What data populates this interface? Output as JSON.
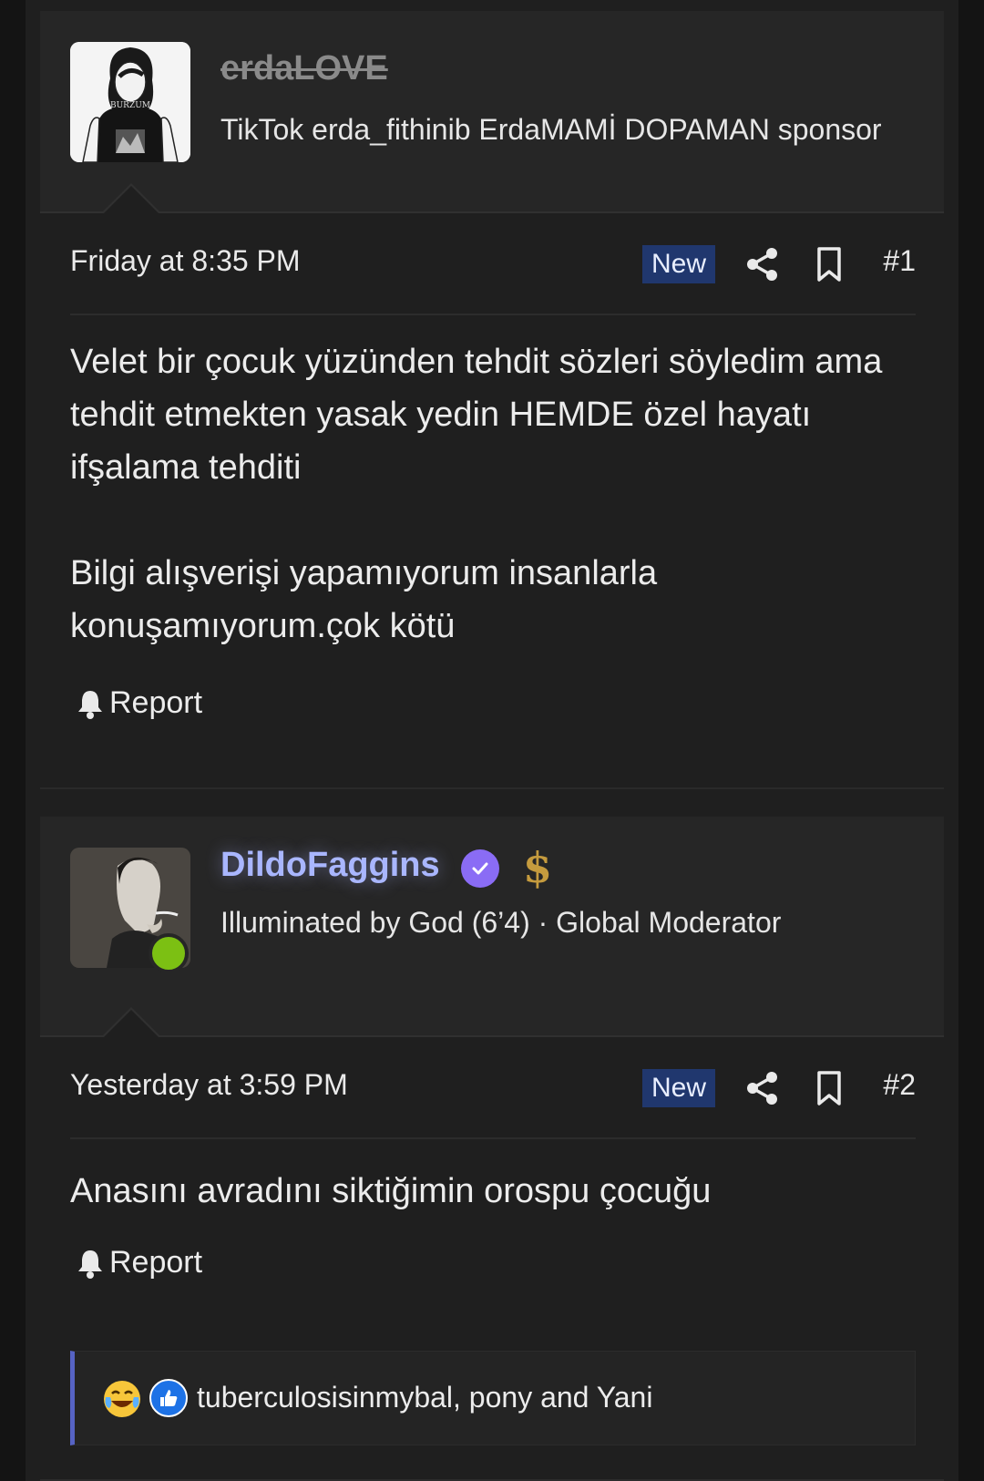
{
  "posts": [
    {
      "username": "erdaLOVE",
      "user_title": "TikTok erda_fithinib ErdaMAMİ DOPAMAN sponsor",
      "date": "Friday at 8:35 PM",
      "badge": "New",
      "post_number": "#1",
      "message": [
        "Velet bir çocuk yüzünden tehdit sözleri söyledim ama tehdit etmekten yasak yedin HEMDE özel hayatı ifşalama tehditi",
        "Bilgi alışverişi yapamıyorum insanlarla konuşamıyorum.çok kötü"
      ],
      "report_label": "Report"
    },
    {
      "username": "DildoFaggins",
      "user_title": "Illuminated by God (6’4) · Global Moderator",
      "date": "Yesterday at 3:59 PM",
      "badge": "New",
      "post_number": "#2",
      "message": [
        "Anasını avradını siktiğimin orospu çocuğu"
      ],
      "report_label": "Report",
      "reactions": {
        "icons": [
          "laughing-crying-emoji",
          "thumbs-up-icon"
        ],
        "users": "tuberculosisinmybal, pony and Yani"
      }
    }
  ],
  "colors": {
    "background": "#1f1f1f",
    "header": "#262626",
    "new_badge": "#20376e",
    "moderator_name": "#a9b6ff",
    "verified": "#8a6cf5",
    "online": "#7cc013",
    "reaction_accent": "#5663c4"
  }
}
